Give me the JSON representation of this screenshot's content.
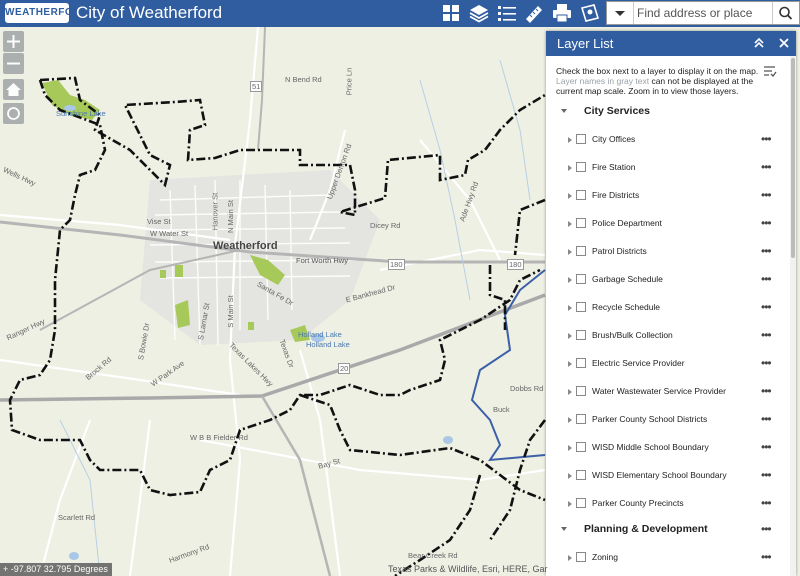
{
  "header": {
    "logo_text": "WEATHERFORD",
    "title": "City of Weatherford",
    "icons": [
      "basemap-gallery-icon",
      "layer-list-icon",
      "legend-icon",
      "measure-icon",
      "print-icon",
      "bookmark-icon"
    ]
  },
  "search": {
    "placeholder": "Find address or place"
  },
  "panel": {
    "title": "Layer List",
    "instructions_1": "Check the box next to a layer to display it on the map. ",
    "instructions_gray": "Layer names in gray text",
    "instructions_2": " can not be displayed at the current map scale. Zoom in to view those layers.",
    "groups": [
      {
        "label": "City Services",
        "layers": [
          "City Offices",
          "Fire Station",
          "Fire Districts",
          "Police Department",
          "Patrol Districts",
          "Garbage Schedule",
          "Recycle Schedule",
          "Brush/Bulk Collection",
          "Electric Service Provider",
          "Water Wastewater Service Provider",
          "Parker County School Districts",
          "WISD Middle School Boundary",
          "WISD Elementary School Boundary",
          "Parker County Precincts"
        ]
      },
      {
        "label": "Planning & Development",
        "layers": [
          "Zoning"
        ]
      }
    ],
    "more_glyph": "•••"
  },
  "map": {
    "labels": {
      "weatherford": "Weatherford",
      "sunshine_lake": "Sunshine Lake",
      "holland_lake_1": "Holland Lake",
      "holland_lake_2": "Holland Lake",
      "n_bend_rd": "N Bend Rd",
      "upper_denton_rd": "Upper Denton Rd",
      "price_ln": "Price Ln",
      "dicey_rd": "Dicey Rd",
      "fort_worth_hwy": "Fort Worth Hwy",
      "e_bankhead_dr": "E Bankhead Dr",
      "vise_st": "Vise St",
      "w_water_st": "W Water St",
      "n_main_st": "N Main St",
      "s_main_st": "S Main St",
      "hanover_st": "Hanover St",
      "santa_fe_dr": "Santa Fe Dr",
      "texas_dr": "Texas Dr",
      "s_bowie_dr": "S Bowie Dr",
      "w_park_ave": "W Park Ave",
      "ranger_hwy": "Ranger Hwy",
      "w_bb_fielder_rd": "W B B Fielder Rd",
      "scarlett_rd": "Scarlett Rd",
      "harmony_rd": "Harmony Rd",
      "bear_creek_rd": "Bear Creek Rd",
      "ade_hwy_rd": "Ade Hwy Rd",
      "hwy_180": "180",
      "hwy_20": "20",
      "hwy_51": "51",
      "buck": "Buck",
      "dobbs_rd": "Dobbs Rd",
      "wells_hwy": "Wells Hwy",
      "texas_lakes_hwy": "Texas Lakes Hwy",
      "s_lamar_st": "S Lamar St",
      "brock_rd": "Brock Rd",
      "bay_st": "Bay St"
    }
  },
  "status": {
    "coordinates": "-97.807 32.795 Degrees",
    "attribution": "Texas Parks & Wildlife, Esri, HERE, Gar"
  },
  "colors": {
    "header_bg": "#2f5d9f",
    "boundary": "#111111",
    "water_line": "#3b5fa8",
    "park": "#a7c95a"
  }
}
